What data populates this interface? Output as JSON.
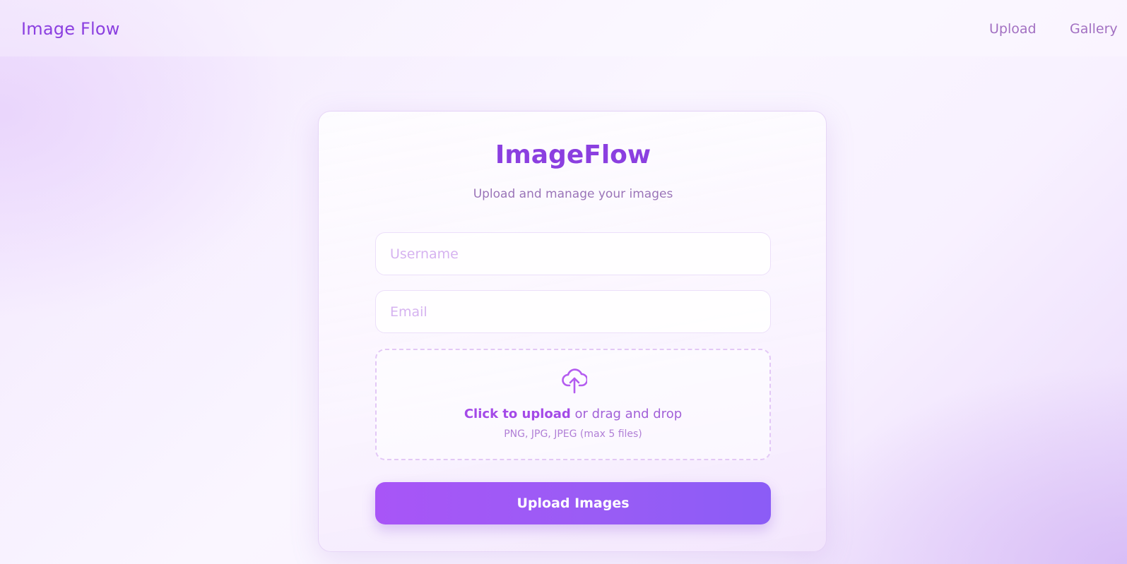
{
  "header": {
    "brand": "Image Flow",
    "nav": [
      {
        "label": "Upload"
      },
      {
        "label": "Gallery"
      }
    ]
  },
  "card": {
    "title": "ImageFlow",
    "subtitle": "Upload and manage your images"
  },
  "form": {
    "username_placeholder": "Username",
    "email_placeholder": "Email",
    "dropzone": {
      "icon": "cloud-upload-icon",
      "link_text": "Click to upload",
      "rest_text": " or drag and drop",
      "hint": "PNG, JPG, JPEG (max 5 files)"
    },
    "submit_label": "Upload Images"
  },
  "colors": {
    "brand": "#8b3fe0",
    "accent_start": "#a855f7",
    "accent_end": "#8b5cf6",
    "nav_text": "#a270c2"
  }
}
